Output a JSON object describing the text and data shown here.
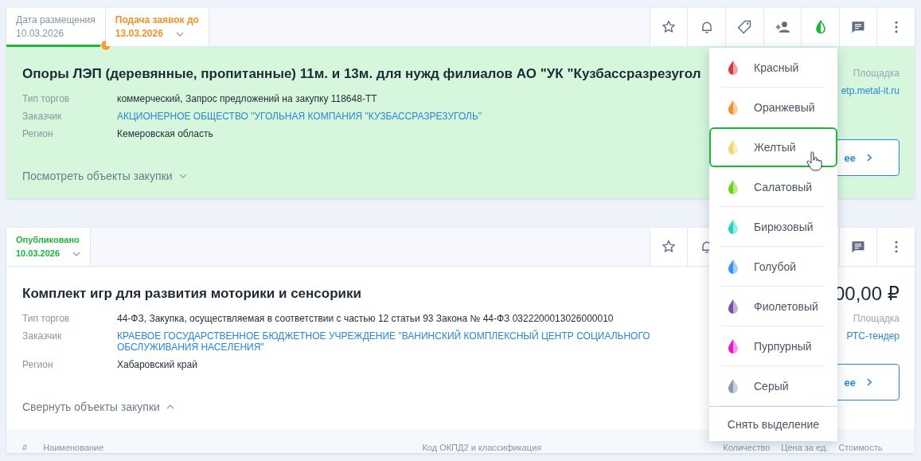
{
  "cards": [
    {
      "color": "#d6f7dc",
      "dates": [
        {
          "kind": "past",
          "label": "Дата размещения",
          "value": "10.03.2026",
          "dropdown": false
        },
        {
          "kind": "deadline",
          "label": "Подача заявок до",
          "value": "13.03.2026",
          "dropdown": true
        }
      ],
      "highlighted": true,
      "title": "Опоры ЛЭП (деревянные, пропитанные) 11м. и 13м. для нужд филиалов АО \"УК \"Кузбассразрезугол",
      "fields": [
        {
          "label": "Тип торгов",
          "value": "коммерческий, Запрос предложений на закупку 118648-ТТ",
          "link": false
        },
        {
          "label": "Заказчик",
          "value": "АКЦИОНЕРНОЕ ОБЩЕСТВО \"УГОЛЬНАЯ КОМПАНИЯ \"КУЗБАССРАЗРЕЗУГОЛЬ\"",
          "link": true
        },
        {
          "label": "Регион",
          "value": "Кемеровская область",
          "link": false
        }
      ],
      "platform_label": "Площадка",
      "platform": "etp.metal-it.ru",
      "details_button": "ее",
      "objects_toggle": {
        "label": "Посмотреть объекты закупки",
        "expanded": false
      }
    },
    {
      "color": "#ffffff",
      "dates": [
        {
          "kind": "published",
          "label": "Опубликовано",
          "value": "10.03.2026",
          "dropdown": true
        }
      ],
      "highlighted": false,
      "title": "Комплект игр для развития моторики и сенсорики",
      "fields": [
        {
          "label": "Тип торгов",
          "value": "44-ФЗ, Закупка, осуществляемая в соответствии с частью 12 статьи 93 Закона № 44-ФЗ 0322200013026000010",
          "link": false
        },
        {
          "label": "Заказчик",
          "value": "КРАЕВОЕ ГОСУДАРСТВЕННОЕ БЮДЖЕТНОЕ УЧРЕЖДЕНИЕ \"ВАНИНСКИЙ КОМПЛЕКСНЫЙ ЦЕНТР СОЦИАЛЬНОГО ОБСЛУЖИВАНИЯ НАСЕЛЕНИЯ\"",
          "link": true
        },
        {
          "label": "Регион",
          "value": "Хабаровский край",
          "link": false
        }
      ],
      "price": "00,00 ₽",
      "platform_label": "Площадка",
      "platform": "РТС-тендер",
      "details_button": "ее",
      "objects_toggle": {
        "label": "Свернуть объекты закупки",
        "expanded": true
      },
      "table": {
        "columns": [
          "#",
          "Наименование",
          "Код ОКПД2 и классификация",
          "Количество",
          "Цена за ед.",
          "Стоимость"
        ]
      }
    }
  ],
  "color_menu": {
    "items": [
      {
        "label": "Красный",
        "color": "#d93a3a",
        "selected": false
      },
      {
        "label": "Оранжевый",
        "color": "#f0922a",
        "selected": false
      },
      {
        "label": "Желтый",
        "color": "#f0d66e",
        "selected": true
      },
      {
        "label": "Салатовый",
        "color": "#6fd119",
        "selected": false
      },
      {
        "label": "Бирюзовый",
        "color": "#22d3be",
        "selected": false
      },
      {
        "label": "Голубой",
        "color": "#3a95e8",
        "selected": false
      },
      {
        "label": "Фиолетовый",
        "color": "#7a4fa0",
        "selected": false
      },
      {
        "label": "Пурпурный",
        "color": "#e01ad0",
        "selected": false
      },
      {
        "label": "Серый",
        "color": "#8c9aaa",
        "selected": false
      }
    ],
    "clear": "Снять выделение"
  }
}
